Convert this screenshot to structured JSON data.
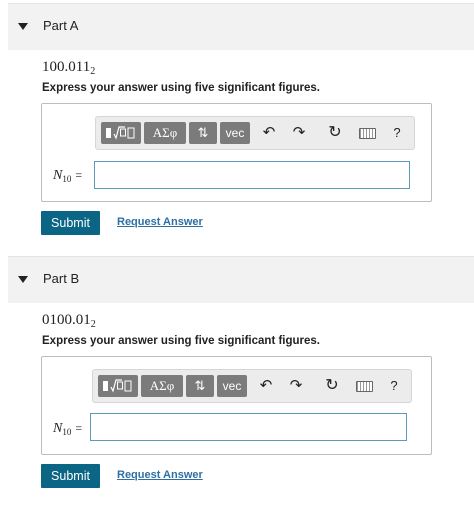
{
  "parts": [
    {
      "title": "Part A",
      "problem_value": "100.011",
      "problem_base": "2",
      "instruction": "Express your answer using five significant figures.",
      "variable": "N",
      "variable_sub": "10",
      "equals": "=",
      "answer_value": "",
      "submit_label": "Submit",
      "request_label": "Request Answer"
    },
    {
      "title": "Part B",
      "problem_value": "0100.01",
      "problem_base": "2",
      "instruction": "Express your answer using five significant figures.",
      "variable": "N",
      "variable_sub": "10",
      "equals": "=",
      "answer_value": "",
      "submit_label": "Submit",
      "request_label": "Request Answer"
    }
  ],
  "toolbar": {
    "greek_label": "ΑΣφ",
    "vec_label": "vec",
    "help_label": "?"
  }
}
